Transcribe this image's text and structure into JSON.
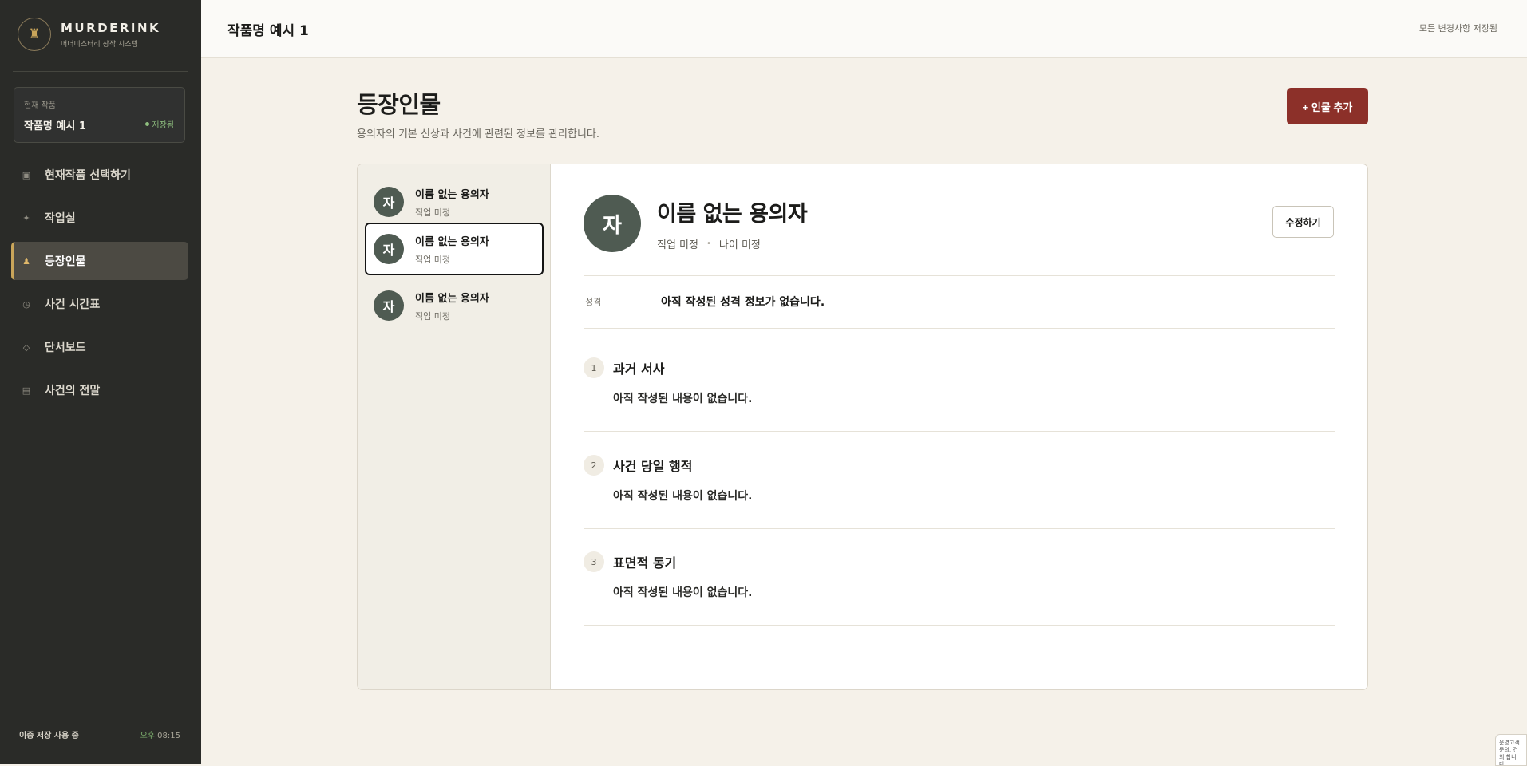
{
  "brand": {
    "logo_glyph": "♜",
    "name": "MURDERINK",
    "subtitle": "머더미스터리 창작 시스템"
  },
  "project": {
    "label": "현재 작품",
    "name": "작품명 예시 1",
    "status": "저장됨"
  },
  "nav": [
    {
      "icon": "▣",
      "icon_name": "square-icon",
      "label": "현재작품 선택하기",
      "active": false
    },
    {
      "icon": "✦",
      "icon_name": "sparkle-icon",
      "label": "작업실",
      "active": false
    },
    {
      "icon": "♟",
      "icon_name": "person-icon",
      "label": "등장인물",
      "active": true
    },
    {
      "icon": "◷",
      "icon_name": "clock-icon",
      "label": "사건 시간표",
      "active": false
    },
    {
      "icon": "◇",
      "icon_name": "diamond-icon",
      "label": "단서보드",
      "active": false
    },
    {
      "icon": "▤",
      "icon_name": "list-icon",
      "label": "사건의 전말",
      "active": false
    }
  ],
  "footer": {
    "left": "이중 저장 사용 중",
    "period": "오후",
    "time": "08:15"
  },
  "topbar": {
    "title": "작품명 예시 1",
    "status": "모든 변경사항 저장됨"
  },
  "page": {
    "title": "등장인물",
    "subtitle": "용의자의 기본 신상과 사건에 관련된 정보를 관리합니다.",
    "add_button": "+ 인물 추가"
  },
  "characters": [
    {
      "avatar": "자",
      "name": "이름 없는 용의자",
      "job": "직업 미정",
      "selected": false
    },
    {
      "avatar": "자",
      "name": "이름 없는 용의자",
      "job": "직업 미정",
      "selected": true
    },
    {
      "avatar": "자",
      "name": "이름 없는 용의자",
      "job": "직업 미정",
      "selected": false
    }
  ],
  "detail": {
    "avatar": "자",
    "name": "이름 없는 용의자",
    "job": "직업 미정",
    "separator": "•",
    "age": "나이 미정",
    "edit_button": "수정하기",
    "trait_label": "성격",
    "trait_value": "아직 작성된 성격 정보가 없습니다.",
    "sections": [
      {
        "num": "1",
        "title": "과거 서사",
        "body": "아직 작성된 내용이 없습니다."
      },
      {
        "num": "2",
        "title": "사건 당일 행적",
        "body": "아직 작성된 내용이 없습니다."
      },
      {
        "num": "3",
        "title": "표면적 동기",
        "body": "아직 작성된 내용이 없습니다."
      }
    ]
  },
  "corner_widget": {
    "text": "운영고객 문의, 건의 합니다."
  },
  "colors": {
    "sidebar": "#2a2b28",
    "accent": "#8c3029",
    "gold": "#c9a55a",
    "avatar": "#4f5b52",
    "saved": "#8fbf7f"
  }
}
